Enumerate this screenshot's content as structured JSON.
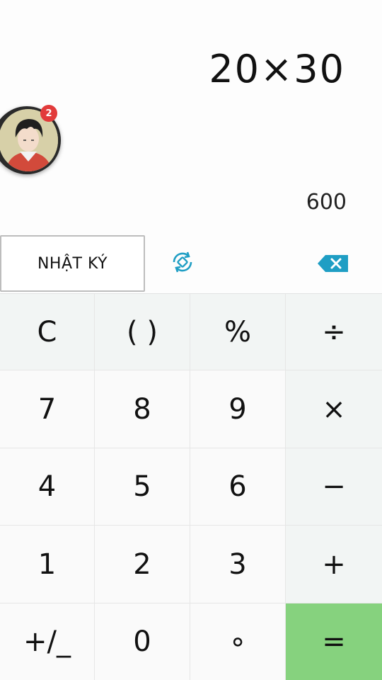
{
  "display": {
    "expression": "20×30",
    "result": "600"
  },
  "chat_head": {
    "badge_count": "2"
  },
  "toolbar": {
    "history_label": "NHẬT KÝ"
  },
  "keypad": {
    "rows": [
      [
        "C",
        "( )",
        "%",
        "÷"
      ],
      [
        "7",
        "8",
        "9",
        "×"
      ],
      [
        "4",
        "5",
        "6",
        "−"
      ],
      [
        "1",
        "2",
        "3",
        "+"
      ],
      [
        "+/_",
        "0",
        "∘",
        "="
      ]
    ]
  },
  "colors": {
    "accent": "#1f9ec4",
    "equals": "#86d27e",
    "badge": "#e23b3b"
  }
}
